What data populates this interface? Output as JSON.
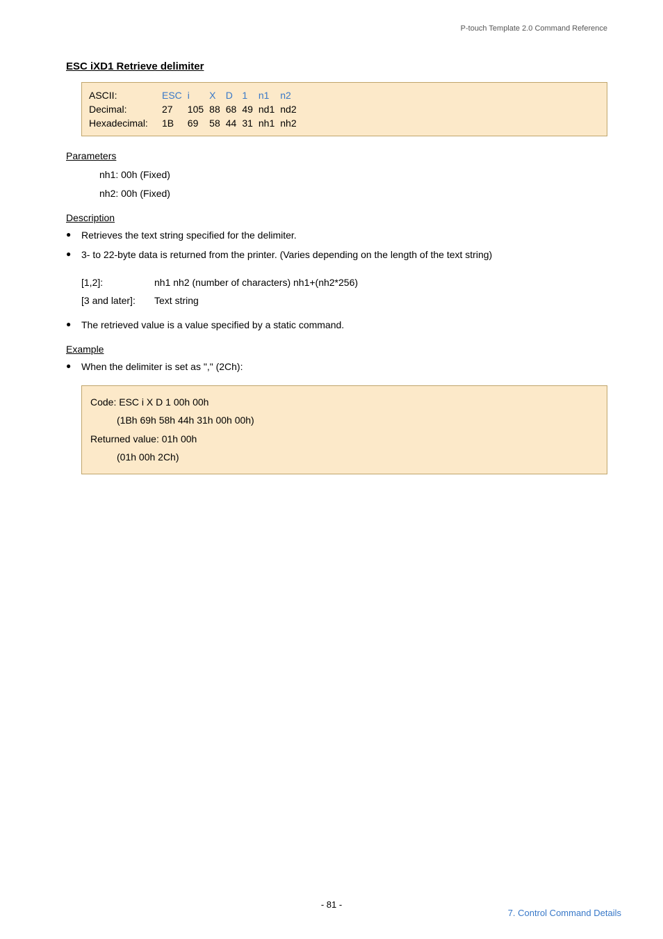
{
  "header": {
    "right": "P-touch Template 2.0 Command Reference"
  },
  "title": "ESC iXD1   Retrieve delimiter",
  "code_table": {
    "rows": [
      {
        "label": "ASCII:",
        "cells": [
          "ESC",
          "i",
          "X",
          "D",
          "1",
          "n1",
          "n2"
        ],
        "blue": true
      },
      {
        "label": "Decimal:",
        "cells": [
          "27",
          "105",
          "88",
          "68",
          "49",
          "nd1",
          "nd2"
        ],
        "blue": false
      },
      {
        "label": "Hexadecimal:",
        "cells": [
          "1B",
          "69",
          "58",
          "44",
          "31",
          "nh1",
          "nh2"
        ],
        "blue": false
      }
    ]
  },
  "parameters": {
    "heading": "Parameters",
    "lines": [
      "nh1: 00h (Fixed)",
      "nh2: 00h (Fixed)"
    ]
  },
  "description": {
    "heading": "Description",
    "bullets": [
      "Retrieves the text string specified for the delimiter.",
      "3- to 22-byte data is returned from the printer. (Varies depending on the length of the text string)"
    ],
    "subitems": [
      {
        "key": "[1,2]:",
        "val": "nh1 nh2 (number of characters) nh1+(nh2*256)"
      },
      {
        "key": "[3 and later]:",
        "val": "Text string"
      }
    ],
    "bullet_after": "The retrieved value is a value specified by a static command."
  },
  "example": {
    "heading": "Example",
    "bullet": "When the delimiter is set as \",\" (2Ch):",
    "lines": {
      "l1": "Code: ESC i X D 1 00h 00h",
      "l2": "(1Bh 69h 58h 44h 31h 00h 00h)",
      "l3": "Returned value: 01h 00h",
      "l4": "(01h 00h 2Ch)"
    }
  },
  "footer": {
    "center": "- 81 -",
    "right": "7. Control Command Details"
  }
}
